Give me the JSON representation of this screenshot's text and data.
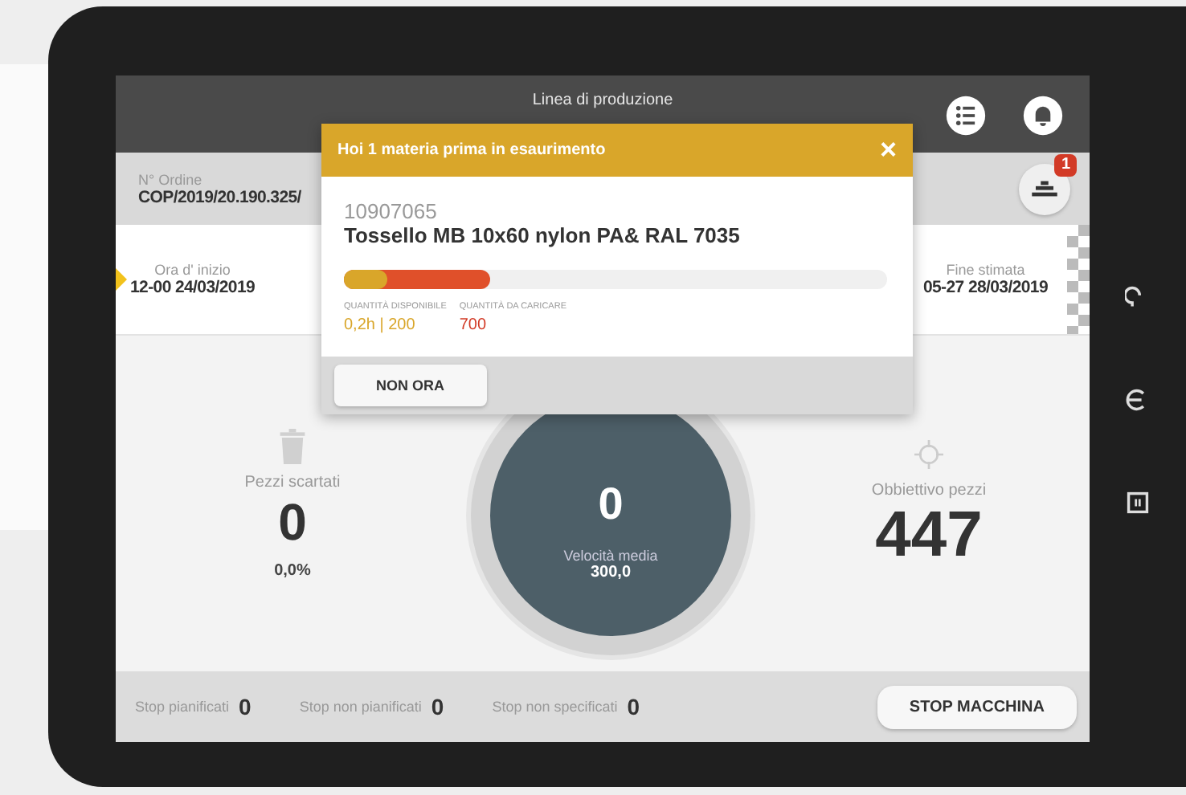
{
  "header": {
    "title": "Linea di produzione"
  },
  "order": {
    "label": "N° Ordine",
    "value": "COP/2019/20.190.325/",
    "materials_badge": "1"
  },
  "info": {
    "start_label": "Ora d' inizio",
    "start_value": "12-00 24/03/2019",
    "end_label": "Fine stimata",
    "end_value": "05-27 28/03/2019"
  },
  "stats": {
    "scrap_label": "Pezzi scartati",
    "scrap_value": "0",
    "scrap_percent": "0,0%",
    "speed_value": "0",
    "speed_label": "Velocità media",
    "speed_avg": "300,0",
    "target_label": "Obbiettivo pezzi",
    "target_value": "447"
  },
  "stops": [
    {
      "label": "Stop pianificati",
      "value": "0"
    },
    {
      "label": "Stop non pianificati",
      "value": "0"
    },
    {
      "label": "Stop non specificati",
      "value": "0"
    }
  ],
  "stop_button": "STOP MACCHINA",
  "modal": {
    "title": "Hoi 1 materia prima in esaurimento",
    "close": "×",
    "code": "10907065",
    "name": "Tossello MB 10x60 nylon PA& RAL 7035",
    "available": {
      "label": "QUANTITÀ DISPONIBILE",
      "value": "0,2h | 200",
      "level": 0.08
    },
    "to_load": {
      "label": "QUANTITÀ DA CARICARE",
      "value": "700",
      "level": 0.27
    },
    "button": "NON ORA"
  }
}
